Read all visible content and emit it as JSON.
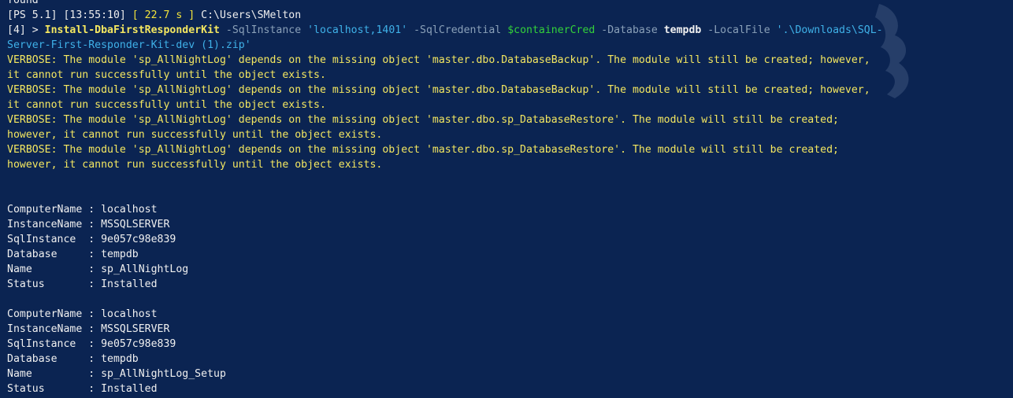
{
  "terminal": {
    "cropped_first_line": "found",
    "prompt": {
      "prefix": "[PS 5.1] [13:55:10] ",
      "duration": "[ 22.7 s ]",
      "path": " C:\\Users\\SMelton"
    },
    "command": {
      "counter": "[4] > ",
      "cmdlet": "Install-DbaFirstResponderKit",
      "p1": " -SqlInstance ",
      "v1": "'localhost,1401'",
      "p2": " -SqlCredential ",
      "v2": "$containerCred",
      "p3": " -Database ",
      "v3": "tempdb",
      "p4": " -LocalFile ",
      "v4a": "'.\\Downloads\\SQL-",
      "v4b": "Server-First-Responder-Kit-dev (1).zip'"
    },
    "verbose": [
      "VERBOSE: The module 'sp_AllNightLog' depends on the missing object 'master.dbo.DatabaseBackup'. The module will still be created; however,",
      "it cannot run successfully until the object exists.",
      "VERBOSE: The module 'sp_AllNightLog' depends on the missing object 'master.dbo.DatabaseBackup'. The module will still be created; however,",
      "it cannot run successfully until the object exists.",
      "VERBOSE: The module 'sp_AllNightLog' depends on the missing object 'master.dbo.sp_DatabaseRestore'. The module will still be created;",
      "however, it cannot run successfully until the object exists.",
      "VERBOSE: The module 'sp_AllNightLog' depends on the missing object 'master.dbo.sp_DatabaseRestore'. The module will still be created;",
      "however, it cannot run successfully until the object exists."
    ],
    "records": [
      [
        "ComputerName : localhost",
        "InstanceName : MSSQLSERVER",
        "SqlInstance  : 9e057c98e839",
        "Database     : tempdb",
        "Name         : sp_AllNightLog",
        "Status       : Installed"
      ],
      [
        "ComputerName : localhost",
        "InstanceName : MSSQLSERVER",
        "SqlInstance  : 9e057c98e839",
        "Database     : tempdb",
        "Name         : sp_AllNightLog_Setup",
        "Status       : Installed"
      ]
    ]
  }
}
